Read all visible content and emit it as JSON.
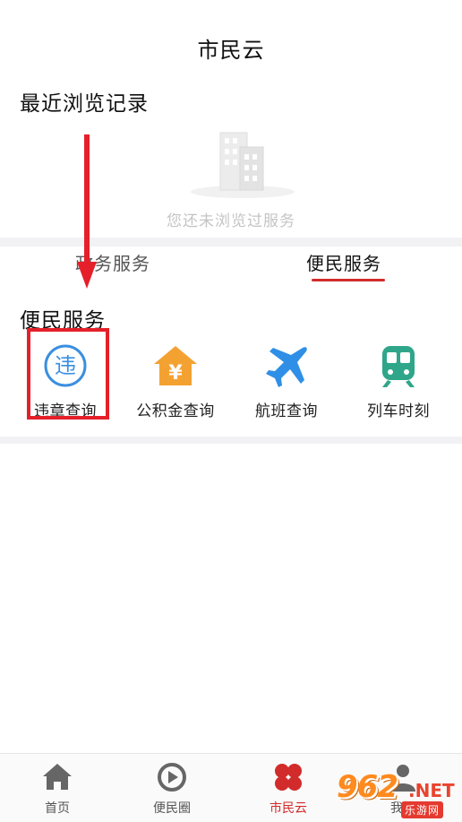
{
  "header": {
    "title": "市民云"
  },
  "recent": {
    "title": "最近浏览记录",
    "empty_text": "您还未浏览过服务"
  },
  "tabs": [
    {
      "label": "政务服务"
    },
    {
      "label": "便民服务"
    }
  ],
  "convenience": {
    "title": "便民服务",
    "items": [
      {
        "label": "违章查询",
        "icon": "violation-icon",
        "glyph": "违",
        "color": "#3a8fe0"
      },
      {
        "label": "公积金查询",
        "icon": "house-fund-icon",
        "glyph": "¥",
        "color": "#f3a232"
      },
      {
        "label": "航班查询",
        "icon": "airplane-icon",
        "color": "#2f8fe6"
      },
      {
        "label": "列车时刻",
        "icon": "train-icon",
        "color": "#2fa68a"
      }
    ]
  },
  "bottom_nav": [
    {
      "label": "首页",
      "icon": "home-icon"
    },
    {
      "label": "便民圈",
      "icon": "circle-play-icon"
    },
    {
      "label": "市民云",
      "icon": "clover-icon",
      "active": true
    },
    {
      "label": "我的",
      "icon": "user-icon"
    }
  ],
  "watermark": {
    "big": "962",
    "net": ".NET",
    "small": "乐游网"
  },
  "colors": {
    "accent": "#d22b2b",
    "annotation": "#e5202a"
  }
}
